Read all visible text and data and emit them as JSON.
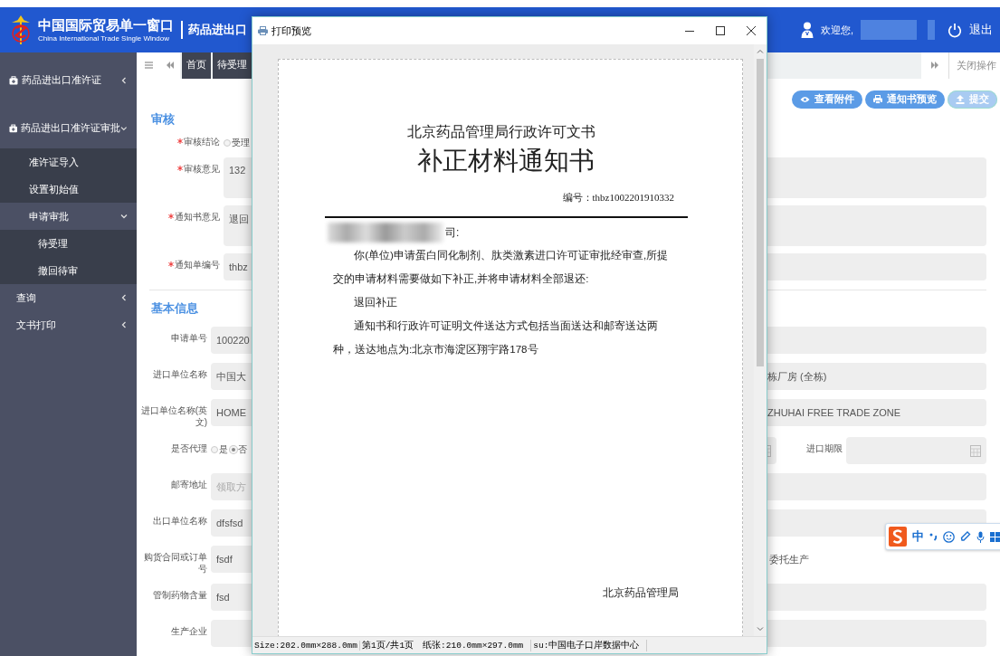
{
  "header": {
    "title": "中国国际贸易单一窗口",
    "subtitle": "China International Trade Single Window",
    "module": "药品进出口",
    "welcome": "欢迎您,",
    "logout": "退出"
  },
  "sidebar": {
    "items": [
      {
        "kind": "module",
        "label": "药品进出口准许证",
        "expanded": false
      },
      {
        "kind": "module",
        "label": "药品进出口准许证审批",
        "expanded": true,
        "children": [
          {
            "label": "准许证导入"
          },
          {
            "label": "设置初始值"
          },
          {
            "label": "申请审批",
            "expanded": true,
            "children": [
              {
                "label": "待受理"
              },
              {
                "label": "撤回待审"
              }
            ]
          }
        ]
      },
      {
        "kind": "menu",
        "label": "查询",
        "expanded": false
      },
      {
        "kind": "menu",
        "label": "文书打印",
        "expanded": false
      }
    ]
  },
  "tabs": {
    "items": [
      {
        "label": "首页"
      },
      {
        "label": "待受理"
      }
    ],
    "close_label": "关闭操作"
  },
  "actions": [
    {
      "kind": "view",
      "label": "查看附件",
      "disabled": false
    },
    {
      "kind": "print",
      "label": "通知书预览",
      "disabled": false
    },
    {
      "kind": "upload",
      "label": "提交",
      "disabled": true
    }
  ],
  "review": {
    "title": "审核",
    "fields": [
      {
        "kind": "radios",
        "label": "审核结论",
        "required": true,
        "options": [
          {
            "label": "受理",
            "selected": false
          }
        ]
      },
      {
        "kind": "textarea",
        "label": "审核意见",
        "required": true,
        "value": "132"
      },
      {
        "kind": "textarea",
        "label": "通知书意见",
        "required": true,
        "value": "退回"
      },
      {
        "kind": "text",
        "label": "通知单编号",
        "required": true,
        "value": "thbz"
      }
    ]
  },
  "basic": {
    "title": "基本信息",
    "fields": [
      {
        "kind": "text",
        "label": "申请单号",
        "required": false,
        "value": "100220"
      },
      {
        "kind": "text",
        "label": "进口单位名称",
        "required": false,
        "value": "中国大",
        "tail": "栋厂房 (全栋)"
      },
      {
        "kind": "text",
        "label": "进口单位名称(英文)",
        "required": false,
        "value": "HOME",
        "tail": "ZHUHAI FREE TRADE ZONE"
      },
      {
        "kind": "radio_date",
        "label": "是否代理",
        "required": false,
        "options": [
          {
            "label": "是",
            "selected": false
          },
          {
            "label": "否",
            "selected": true
          }
        ],
        "date_label": "进口期限"
      },
      {
        "kind": "text",
        "label": "邮寄地址",
        "required": false,
        "placeholder": "领取方"
      },
      {
        "kind": "text",
        "label": "出口单位名称",
        "required": false,
        "value": "dfsfsd"
      },
      {
        "kind": "text_note",
        "label": "购货合同或订单号",
        "required": false,
        "value": "fsdf",
        "note": "委托生产"
      },
      {
        "kind": "text",
        "label": "管制药物含量",
        "required": false,
        "value": "fsd"
      },
      {
        "kind": "text",
        "label": "生产企业",
        "required": false
      }
    ]
  },
  "dialog": {
    "title": "打印预览",
    "document": {
      "header": "北京药品管理局行政许可文书",
      "title": "补正材料通知书",
      "number": "编号：thbz1002201910332",
      "salutation": "司:",
      "paragraphs": [
        "你(单位)申请蛋白同化制剂、肽类激素进口许可证审批经审查,所提交的申请材料需要做如下补正,并将申请材料全部退还:",
        "退回补正",
        "通知书和行政许可证明文件送达方式包括当面送达和邮寄送达两种，送达地点为:北京市海淀区翔宇路178号"
      ],
      "signature": "北京药品管理局"
    },
    "status": [
      "Size:202.0mm×288.0mm",
      "第1页/共1页",
      "纸张:210.0mm×297.0mm",
      "su:中国电子口岸数据中心"
    ]
  },
  "ime": {
    "mode": "中"
  }
}
